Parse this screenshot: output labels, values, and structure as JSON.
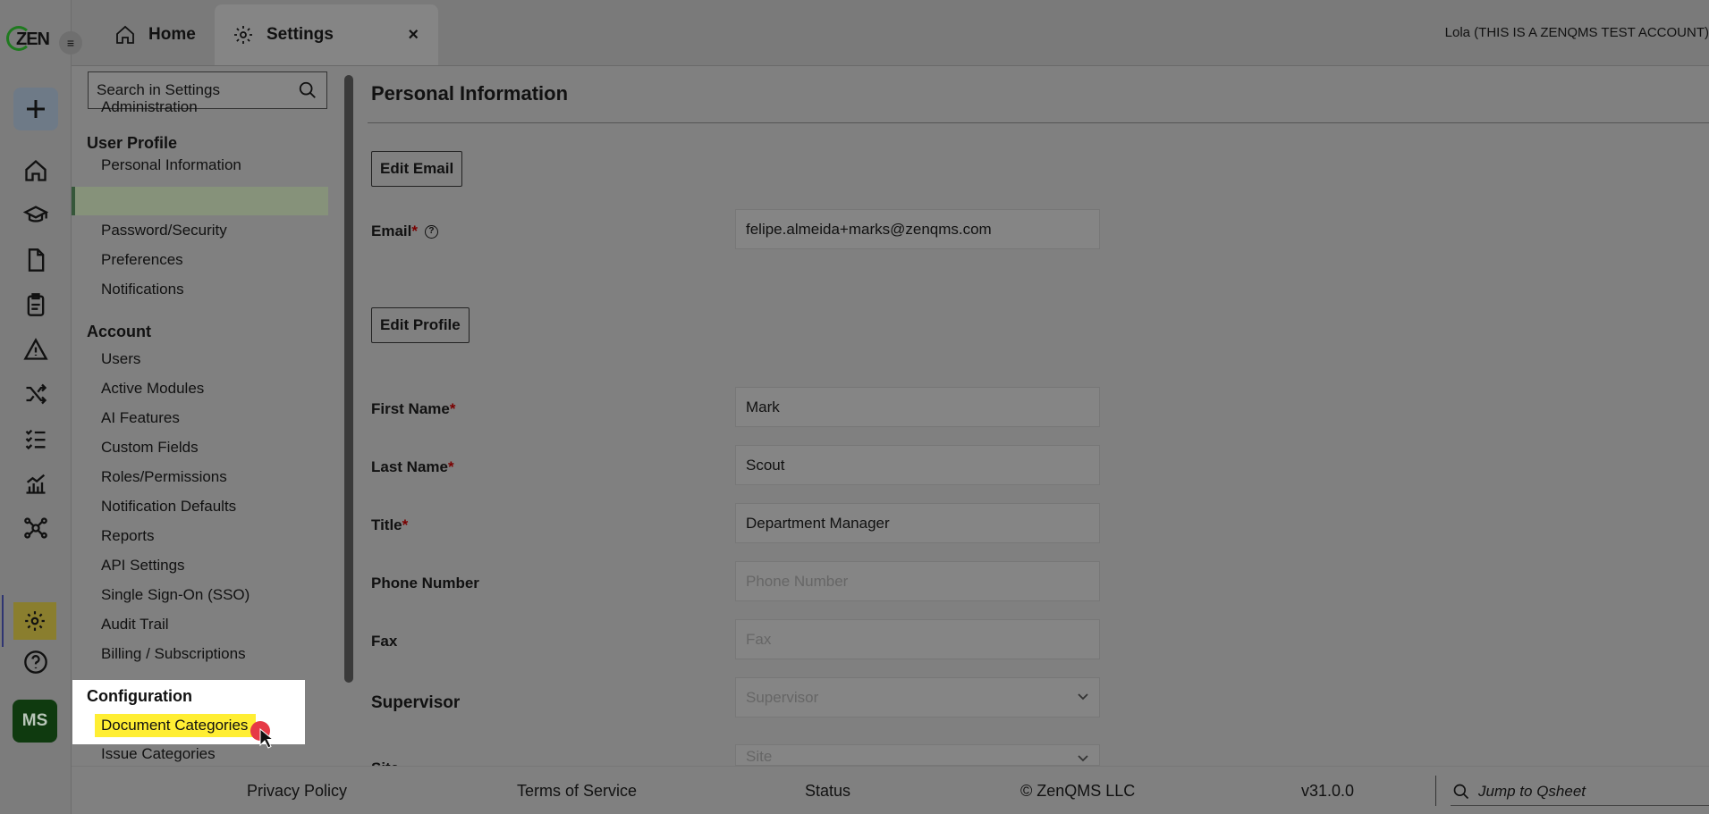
{
  "brand": {
    "logo_text": "ZEN"
  },
  "rail": {
    "avatar_initials": "MS",
    "icons": [
      "plus-icon",
      "home-icon",
      "graduation-cap-icon",
      "document-icon",
      "clipboard-icon",
      "warning-icon",
      "shuffle-icon",
      "checklist-icon",
      "analytics-icon",
      "network-icon",
      "gear-icon",
      "help-icon"
    ]
  },
  "tabs": [
    {
      "label": "Home",
      "icon": "home-icon"
    },
    {
      "label": "Settings",
      "icon": "gear-icon",
      "close": "×"
    }
  ],
  "account": {
    "name": "Lola (THIS IS A ZENQMS TEST ACCOUNT)"
  },
  "settings_nav": {
    "search_placeholder": "Search in Settings",
    "administration": "Administration",
    "user_profile": {
      "header": "User Profile",
      "items": [
        "Personal Information",
        "Password/Security",
        "Preferences",
        "Notifications"
      ]
    },
    "account": {
      "header": "Account",
      "items": [
        "Users",
        "Active Modules",
        "AI Features",
        "Custom Fields",
        "Roles/Permissions",
        "Notification Defaults",
        "Reports",
        "API Settings",
        "Single Sign-On (SSO)",
        "Audit Trail",
        "Billing / Subscriptions"
      ]
    },
    "configuration": {
      "header": "Configuration",
      "items": [
        "Document Categories",
        "Issue Categories"
      ]
    }
  },
  "main": {
    "title": "Personal Information",
    "edit_email": "Edit Email",
    "edit_profile": "Edit Profile",
    "fields": {
      "email": {
        "label": "Email",
        "value": "felipe.almeida+marks@zenqms.com"
      },
      "first_name": {
        "label": "First Name",
        "value": "Mark"
      },
      "last_name": {
        "label": "Last Name",
        "value": "Scout"
      },
      "title": {
        "label": "Title",
        "value": "Department Manager"
      },
      "phone": {
        "label": "Phone Number",
        "placeholder": "Phone Number"
      },
      "fax": {
        "label": "Fax",
        "placeholder": "Fax"
      },
      "supervisor": {
        "label": "Supervisor",
        "placeholder": "Supervisor"
      },
      "site": {
        "label": "Site",
        "placeholder": "Site"
      }
    },
    "required_mark": "*"
  },
  "footer": {
    "privacy": "Privacy Policy",
    "terms": "Terms of Service",
    "status": "Status",
    "copyright": "© ZenQMS LLC",
    "version": "v31.0.0",
    "qsheet_placeholder": "Jump to Qsheet"
  },
  "colors": {
    "highlight": "#ffee33",
    "active_nav": "#86927a",
    "avatar_bg": "#0f3a0f",
    "click_dot": "#e63946"
  }
}
